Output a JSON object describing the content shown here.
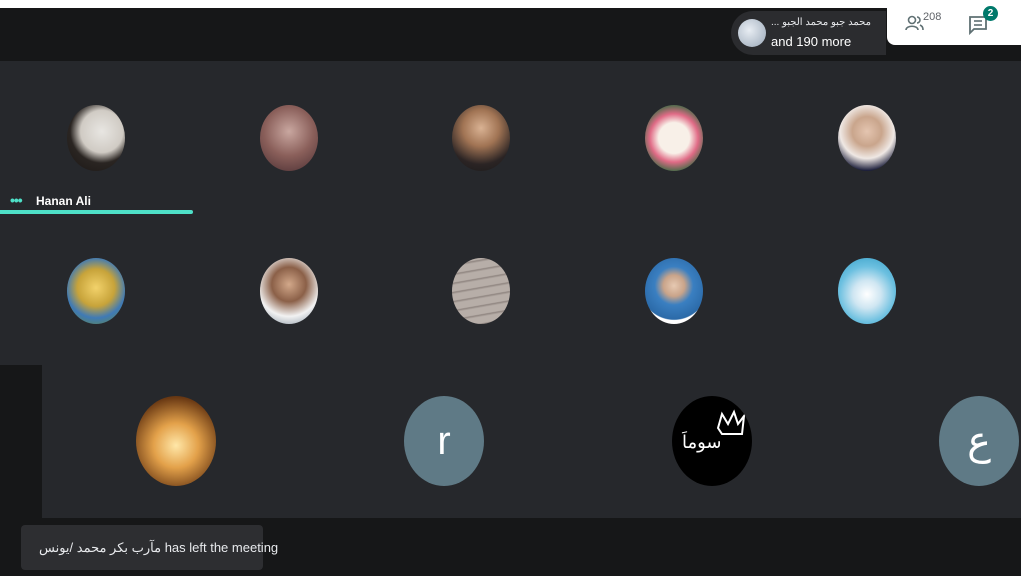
{
  "header": {
    "participants_pill": {
      "names": "... محمد جبو محمد الجبو",
      "more_text": "and 190 more"
    },
    "people_count": "208",
    "chat_badge": "2"
  },
  "speaker": {
    "name": "Hanan Ali",
    "indicator": "•••"
  },
  "tiles_row3": {
    "letter_r": "r",
    "letter_ain": "ع",
    "crown_text": "سوماَ"
  },
  "toast": {
    "text": "مآرب بكر محمد /يونس has left the meeting"
  },
  "colors": {
    "accent": "#4ee0c8",
    "badge": "#00796b",
    "background": "#202124"
  }
}
